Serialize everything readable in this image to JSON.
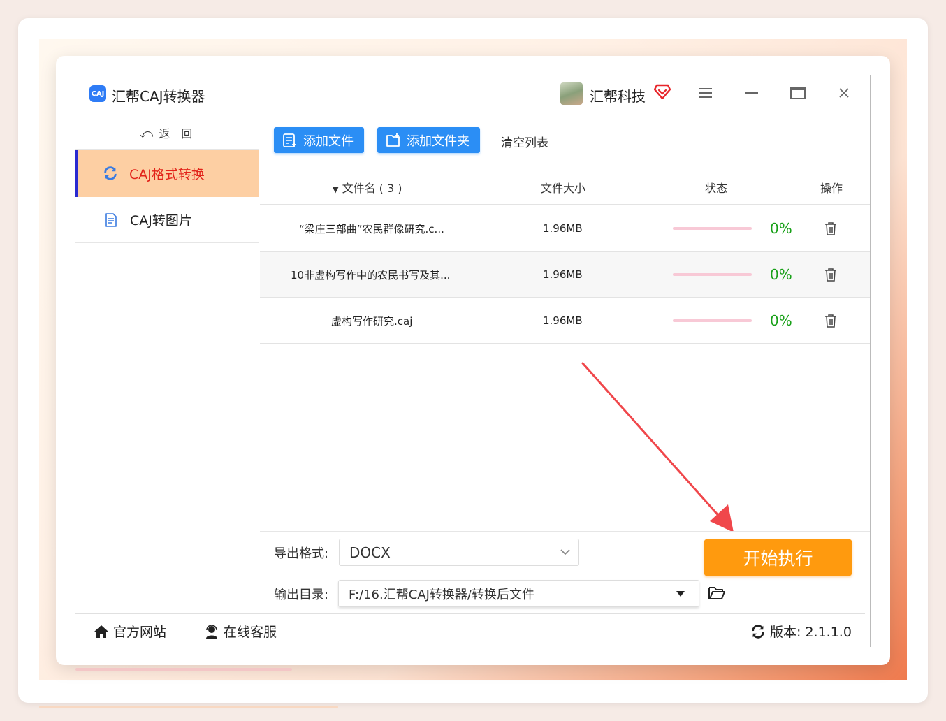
{
  "app": {
    "logo_text": "CAJ",
    "title": "汇帮CAJ转换器"
  },
  "user": {
    "name": "汇帮科技"
  },
  "sidebar": {
    "back_label": "返　回",
    "items": [
      {
        "label": "CAJ格式转换",
        "active": true
      },
      {
        "label": "CAJ转图片",
        "active": false
      }
    ]
  },
  "toolbar": {
    "add_file": "添加文件",
    "add_folder": "添加文件夹",
    "clear_list": "清空列表"
  },
  "table": {
    "headers": {
      "name": "文件名 ( 3 )",
      "size": "文件大小",
      "status": "状态",
      "action": "操作"
    },
    "rows": [
      {
        "name": "“梁庄三部曲”农民群像研究.c...",
        "size": "1.96MB",
        "progress_pct": "0%",
        "progress": 0
      },
      {
        "name": "10非虚构写作中的农民书写及其...",
        "size": "1.96MB",
        "progress_pct": "0%",
        "progress": 0
      },
      {
        "name": "虚构写作研究.caj",
        "size": "1.96MB",
        "progress_pct": "0%",
        "progress": 0
      }
    ]
  },
  "output": {
    "format_label": "导出格式:",
    "format_value": "DOCX",
    "dir_label": "输出目录:",
    "dir_value": "F:/16.汇帮CAJ转换器/转换后文件",
    "start_button": "开始执行"
  },
  "footer": {
    "website": "官方网站",
    "support": "在线客服",
    "version": "版本:  2.1.1.0"
  },
  "colors": {
    "accent_blue": "#2b8ef5",
    "start_orange": "#ff9a0e",
    "active_red": "#e2231a",
    "progress_green": "#18a018"
  }
}
